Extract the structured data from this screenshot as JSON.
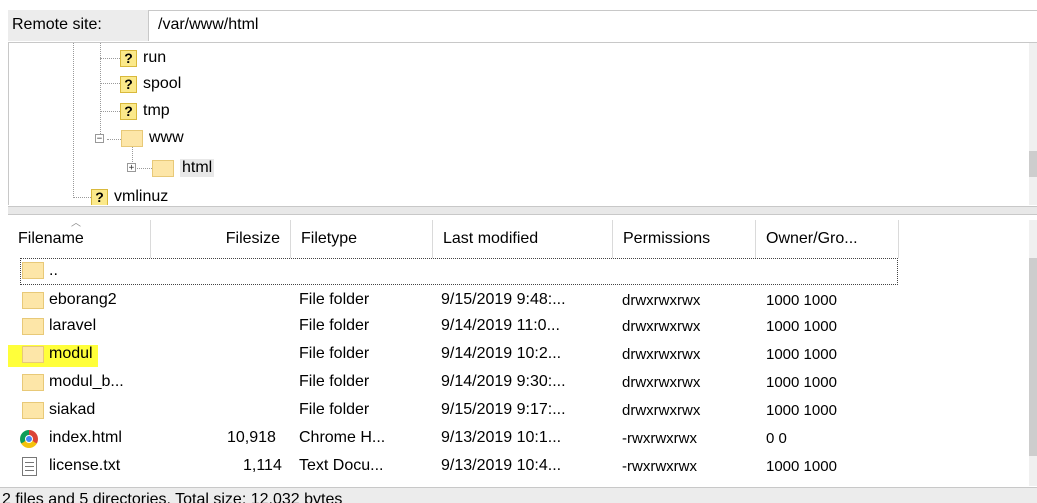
{
  "site_bar": {
    "label": "Remote site:",
    "path": "/var/www/html"
  },
  "tree": {
    "items": [
      {
        "label": "run",
        "icon": "question-icon"
      },
      {
        "label": "spool",
        "icon": "question-icon"
      },
      {
        "label": "tmp",
        "icon": "question-icon"
      },
      {
        "label": "www",
        "icon": "folder-icon"
      },
      {
        "label": "html",
        "icon": "folder-icon"
      },
      {
        "label": "vmlinuz",
        "icon": "question-icon"
      }
    ]
  },
  "file_list": {
    "columns": [
      "Filename",
      "Filesize",
      "Filetype",
      "Last modified",
      "Permissions",
      "Owner/Gro..."
    ],
    "parent_dir": "..",
    "rows": [
      {
        "name": "eborang2",
        "size": "",
        "type": "File folder",
        "modified": "9/15/2019 9:48:...",
        "perms": "drwxrwxrwx",
        "owner": "1000 1000",
        "icon": "folder-icon"
      },
      {
        "name": "laravel",
        "size": "",
        "type": "File folder",
        "modified": "9/14/2019 11:0...",
        "perms": "drwxrwxrwx",
        "owner": "1000 1000",
        "icon": "folder-icon"
      },
      {
        "name": "modul",
        "size": "",
        "type": "File folder",
        "modified": "9/14/2019 10:2...",
        "perms": "drwxrwxrwx",
        "owner": "1000 1000",
        "icon": "folder-icon",
        "highlighted": true
      },
      {
        "name": "modul_b...",
        "size": "",
        "type": "File folder",
        "modified": "9/14/2019 9:30:...",
        "perms": "drwxrwxrwx",
        "owner": "1000 1000",
        "icon": "folder-icon"
      },
      {
        "name": "siakad",
        "size": "",
        "type": "File folder",
        "modified": "9/15/2019 9:17:...",
        "perms": "drwxrwxrwx",
        "owner": "1000 1000",
        "icon": "folder-icon"
      },
      {
        "name": "index.html",
        "size": "10,918",
        "type": "Chrome H...",
        "modified": "9/13/2019 10:1...",
        "perms": "-rwxrwxrwx",
        "owner": "0 0",
        "icon": "chrome-icon"
      },
      {
        "name": "license.txt",
        "size": "1,114",
        "type": "Text Docu...",
        "modified": "9/13/2019 10:4...",
        "perms": "-rwxrwxrwx",
        "owner": "1000 1000",
        "icon": "text-file-icon"
      }
    ]
  },
  "status": {
    "text": "2 files and 5 directories. Total size: 12,032 bytes"
  },
  "colors": {
    "highlight": "#ffff3a",
    "folder": "#fde6a8",
    "question": "#fbe98a"
  }
}
